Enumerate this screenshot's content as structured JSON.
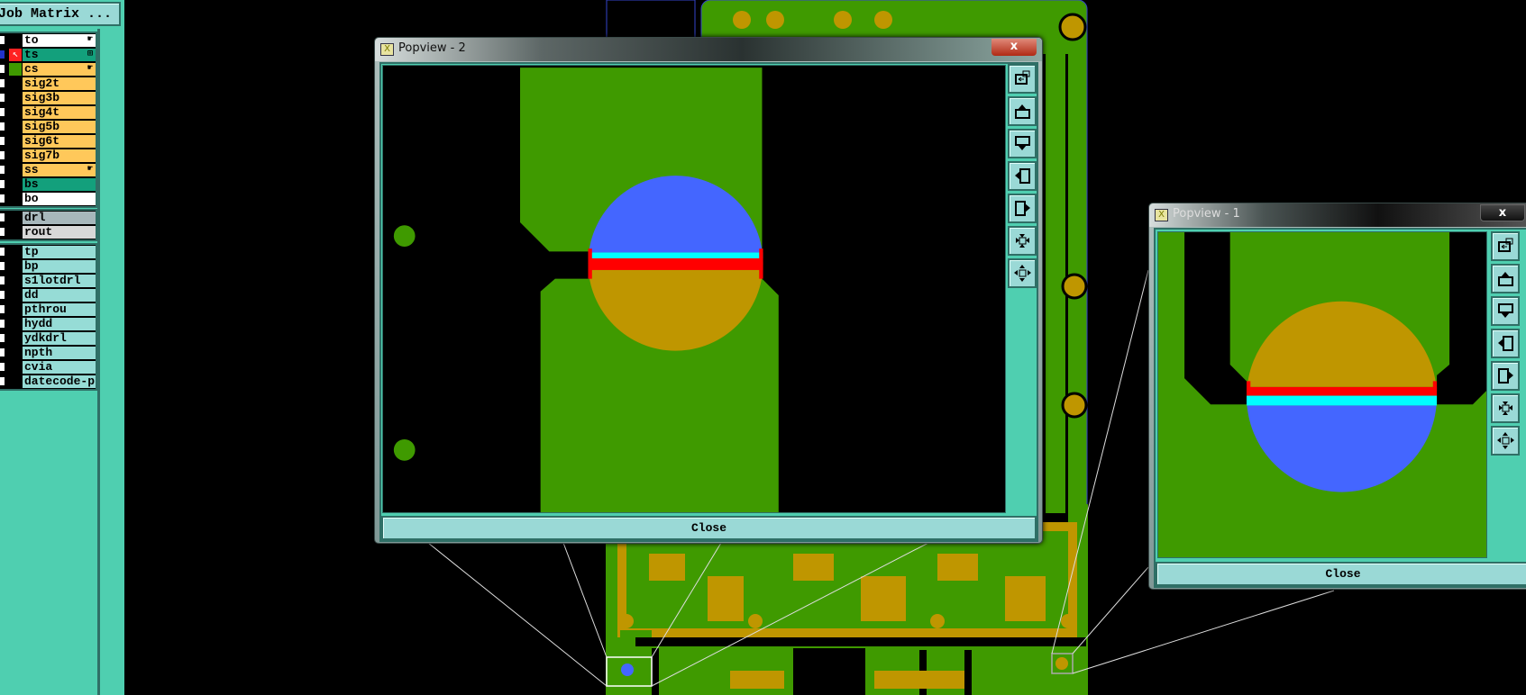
{
  "job_matrix_button": "Job Matrix ...",
  "layers": {
    "board": [
      {
        "name": "to",
        "color": "#ffffff",
        "marker": "hand"
      },
      {
        "name": "ts",
        "color": "#13a07c",
        "marker": "grid",
        "work": "true"
      },
      {
        "name": "cs",
        "color": "#ffc85a",
        "marker": "hand",
        "affected": "true"
      },
      {
        "name": "sig2t",
        "color": "#ffc85a"
      },
      {
        "name": "sig3b",
        "color": "#ffc85a"
      },
      {
        "name": "sig4t",
        "color": "#ffc85a"
      },
      {
        "name": "sig5b",
        "color": "#ffc85a"
      },
      {
        "name": "sig6t",
        "color": "#ffc85a"
      },
      {
        "name": "sig7b",
        "color": "#ffc85a"
      },
      {
        "name": "ss",
        "color": "#ffc85a",
        "marker": "hand"
      },
      {
        "name": "bs",
        "color": "#13a07c"
      },
      {
        "name": "bo",
        "color": "#ffffff"
      }
    ],
    "drill": [
      {
        "name": "drl",
        "color": "#a7b7bb"
      },
      {
        "name": "rout",
        "color": "#d8d8d8"
      }
    ],
    "misc": [
      {
        "name": "tp",
        "color": "#96dcd6"
      },
      {
        "name": "bp",
        "color": "#96dcd6"
      },
      {
        "name": "s1lotdrl",
        "color": "#96dcd6"
      },
      {
        "name": "dd",
        "color": "#96dcd6"
      },
      {
        "name": "pthrou",
        "color": "#96dcd6"
      },
      {
        "name": "hydd",
        "color": "#96dcd6"
      },
      {
        "name": "ydkdrl",
        "color": "#96dcd6"
      },
      {
        "name": "npth",
        "color": "#96dcd6"
      },
      {
        "name": "cvia",
        "color": "#96dcd6"
      },
      {
        "name": "datecode-ptc",
        "color": "#96dcd6"
      }
    ]
  },
  "popview2": {
    "title": "Popview - 2",
    "close_x": "x",
    "close_label": "Close"
  },
  "popview1": {
    "title": "Popview - 1",
    "close_x": "x",
    "close_label": "Close"
  },
  "toolbar_icons": [
    "window-restore-icon",
    "move-up-icon",
    "move-down-icon",
    "move-left-icon",
    "move-right-icon",
    "zoom-in-icon",
    "zoom-out-icon"
  ],
  "colors": {
    "copper": "#3f9a00",
    "pad": "#bf9600",
    "top_half": "#4466ff",
    "cyan": "#00ffff",
    "red": "#ff0000",
    "panel": "#4fcfb0"
  }
}
